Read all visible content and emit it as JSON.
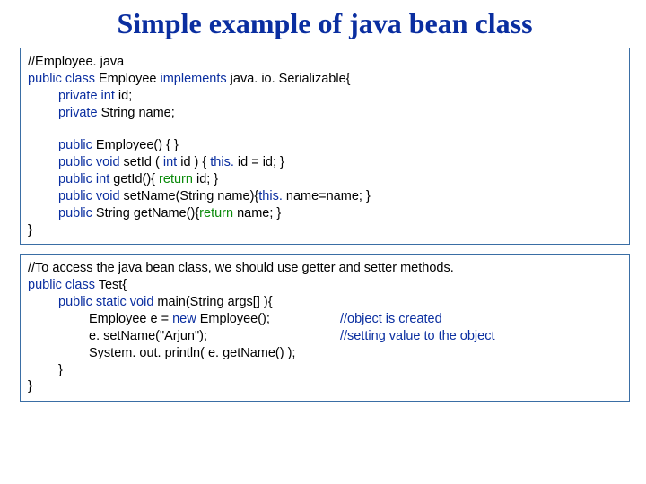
{
  "title": "Simple example of java bean class",
  "box1": {
    "l0": "//Employee. java",
    "l1_a": "public class ",
    "l1_b": "Employee ",
    "l1_c": "implements ",
    "l1_d": "java. io. Serializable{",
    "l2_a": "private int ",
    "l2_b": "id;",
    "l3_a": "private ",
    "l3_b": "String name;",
    "l4_a": "public ",
    "l4_b": "Employee() { }",
    "l5_a": "public void ",
    "l5_b": "setId ( ",
    "l5_c": "int ",
    "l5_d": "id ) { ",
    "l5_e": "this. ",
    "l5_f": "id = id; }",
    "l6_a": "public int ",
    "l6_b": "getId(){ ",
    "l6_c": "return ",
    "l6_d": "id; }",
    "l7_a": "public void ",
    "l7_b": "setName(String name){",
    "l7_c": "this. ",
    "l7_d": "name=name; }",
    "l8_a": "public ",
    "l8_b": "String getName(){",
    "l8_c": "return ",
    "l8_d": "name; }",
    "l9": "}"
  },
  "box2": {
    "l0": "//To access the java bean class, we should use getter and setter methods.",
    "l1_a": "public class ",
    "l1_b": "Test{",
    "l2_a": "public static void ",
    "l2_b": "main(String args[] ){",
    "l3_a": "Employee e = ",
    "l3_b": "new ",
    "l3_c": "Employee();",
    "l3_cmt": "//object is created",
    "l4": "e. setName(\"Arjun\");",
    "l4_cmt": "//setting value to the object",
    "l5": "System. out. println( e. getName() );",
    "l6": "}",
    "l7": "}"
  }
}
